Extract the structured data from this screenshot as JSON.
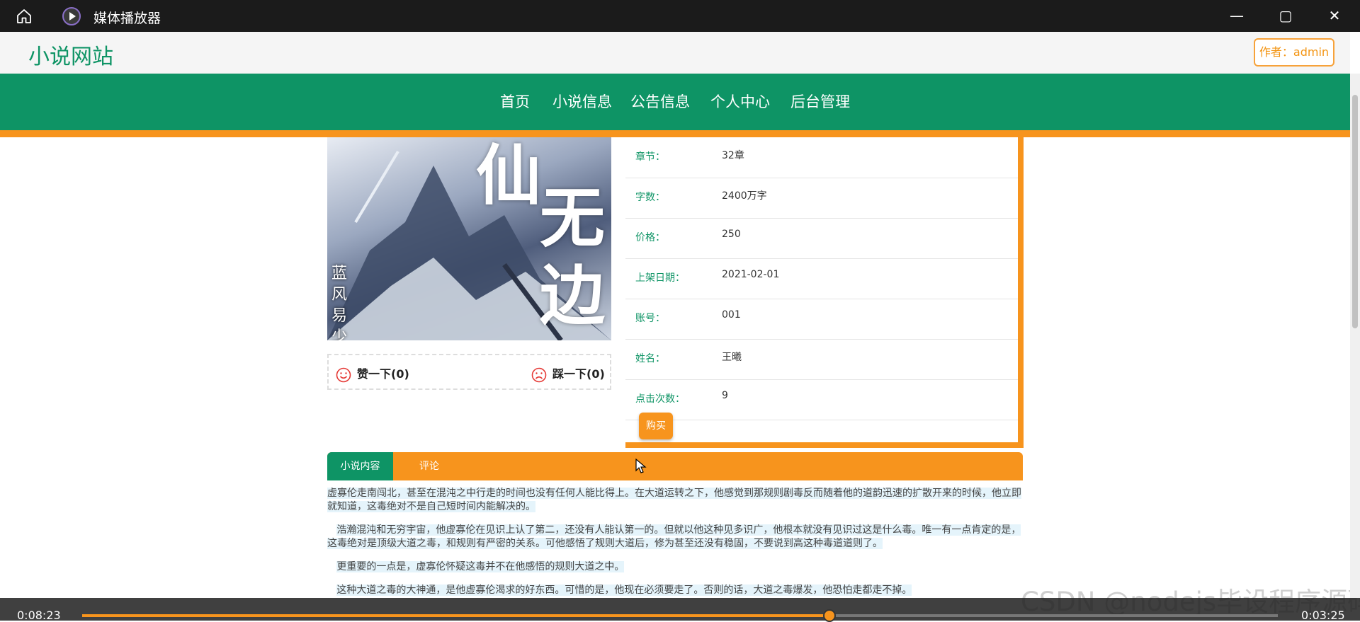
{
  "window": {
    "title": "媒体播放器",
    "controls": [
      "—",
      "▢",
      "✕"
    ]
  },
  "site": {
    "logo": "小说网站",
    "author_button": "作者：admin"
  },
  "nav": {
    "items": [
      "首页",
      "小说信息",
      "公告信息",
      "个人中心",
      "后台管理"
    ]
  },
  "cover": {
    "chars": [
      "仙",
      "无",
      "边"
    ],
    "author_vertical": "蓝风易少"
  },
  "votes": {
    "like": "赞一下(0)",
    "dislike": "踩一下(0)"
  },
  "info": {
    "rows": [
      {
        "label": "章节：",
        "value": "32章"
      },
      {
        "label": "字数：",
        "value": "2400万字"
      },
      {
        "label": "价格：",
        "value": "250"
      },
      {
        "label": "上架日期：",
        "value": "2021-02-01"
      },
      {
        "label": "账号：",
        "value": "001"
      },
      {
        "label": "姓名：",
        "value": "王曦"
      },
      {
        "label": "点击次数：",
        "value": "9"
      }
    ],
    "buy_button": "购买"
  },
  "tabs": {
    "content": "小说内容",
    "comment": "评论"
  },
  "content": {
    "paragraphs": [
      "虚寡伦走南闯北，甚至在混沌之中行走的时间也没有任何人能比得上。在大道运转之下，他感觉到那规则剧毒反而随着他的道韵迅速的扩散开来的时候，他立即就知道，这毒绝对不是自己短时间内能解决的。",
      "浩瀚混沌和无穷宇宙，他虚寡伦在见识上认了第二，还没有人能认第一的。但就以他这种见多识广，他根本就没有见识过这是什么毒。唯一有一点肯定的是，这毒绝对是顶级大道之毒，和规则有严密的关系。可他感悟了规则大道后，修为甚至还没有稳固，不要说到高这种毒道道则了。",
      "更重要的一点是，虚寡伦怀疑这毒并不在他感悟的规则大道之中。",
      "这种大道之毒的大神通，是他虚寡伦渴求的好东西。可惜的是，他现在必须要走了。否则的话，大道之毒爆发，他恐怕走都走不掉。"
    ]
  },
  "watermark": "CSDN @nodejs毕设程序源码",
  "player": {
    "current_time": "0:08:23",
    "total_time": "0:03:25",
    "progress": 0.625
  }
}
